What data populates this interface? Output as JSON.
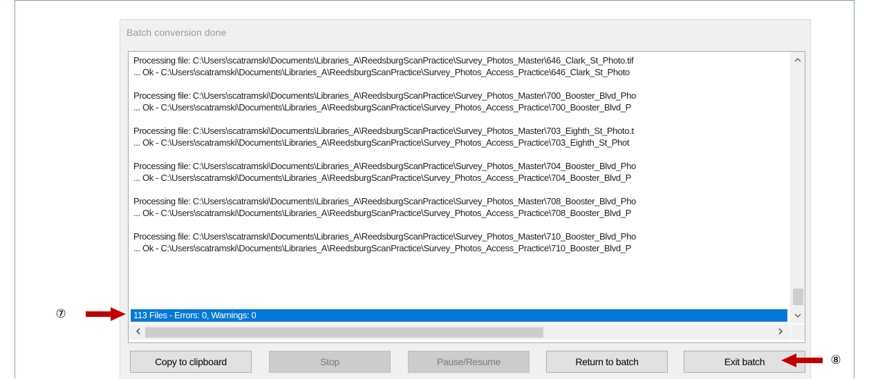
{
  "dialog": {
    "title": "Batch conversion done"
  },
  "log": {
    "entries": [
      {
        "processing": "Processing file: C:\\Users\\scatramski\\Documents\\Libraries_A\\ReedsburgScanPractice\\Survey_Photos_Master\\646_Clark_St_Photo.tif",
        "ok": "... Ok - C:\\Users\\scatramski\\Documents\\Libraries_A\\ReedsburgScanPractice\\Survey_Photos_Access_Practice\\646_Clark_St_Photo"
      },
      {
        "processing": "Processing file: C:\\Users\\scatramski\\Documents\\Libraries_A\\ReedsburgScanPractice\\Survey_Photos_Master\\700_Booster_Blvd_Pho",
        "ok": "... Ok - C:\\Users\\scatramski\\Documents\\Libraries_A\\ReedsburgScanPractice\\Survey_Photos_Access_Practice\\700_Booster_Blvd_P"
      },
      {
        "processing": "Processing file: C:\\Users\\scatramski\\Documents\\Libraries_A\\ReedsburgScanPractice\\Survey_Photos_Master\\703_Eighth_St_Photo.t",
        "ok": "... Ok - C:\\Users\\scatramski\\Documents\\Libraries_A\\ReedsburgScanPractice\\Survey_Photos_Access_Practice\\703_Eighth_St_Phot"
      },
      {
        "processing": "Processing file: C:\\Users\\scatramski\\Documents\\Libraries_A\\ReedsburgScanPractice\\Survey_Photos_Master\\704_Booster_Blvd_Pho",
        "ok": "... Ok - C:\\Users\\scatramski\\Documents\\Libraries_A\\ReedsburgScanPractice\\Survey_Photos_Access_Practice\\704_Booster_Blvd_P"
      },
      {
        "processing": "Processing file: C:\\Users\\scatramski\\Documents\\Libraries_A\\ReedsburgScanPractice\\Survey_Photos_Master\\708_Booster_Blvd_Pho",
        "ok": "... Ok - C:\\Users\\scatramski\\Documents\\Libraries_A\\ReedsburgScanPractice\\Survey_Photos_Access_Practice\\708_Booster_Blvd_P"
      },
      {
        "processing": "Processing file: C:\\Users\\scatramski\\Documents\\Libraries_A\\ReedsburgScanPractice\\Survey_Photos_Master\\710_Booster_Blvd_Pho",
        "ok": "... Ok - C:\\Users\\scatramski\\Documents\\Libraries_A\\ReedsburgScanPractice\\Survey_Photos_Access_Practice\\710_Booster_Blvd_P"
      }
    ],
    "summary": "113 Files - Errors: 0, Warnings: 0",
    "selection_color": "#0078d7"
  },
  "scrollbars": {
    "up_icon": "chevron-up-icon",
    "down_icon": "chevron-down-icon",
    "left_icon": "chevron-left-icon",
    "right_icon": "chevron-right-icon"
  },
  "buttons": {
    "copy": "Copy to clipboard",
    "stop": "Stop",
    "pause": "Pause/Resume",
    "return": "Return to batch",
    "exit": "Exit batch"
  },
  "annotations": {
    "callout_7": "⑦",
    "callout_8": "⑧",
    "arrow_color": "#c00000"
  }
}
